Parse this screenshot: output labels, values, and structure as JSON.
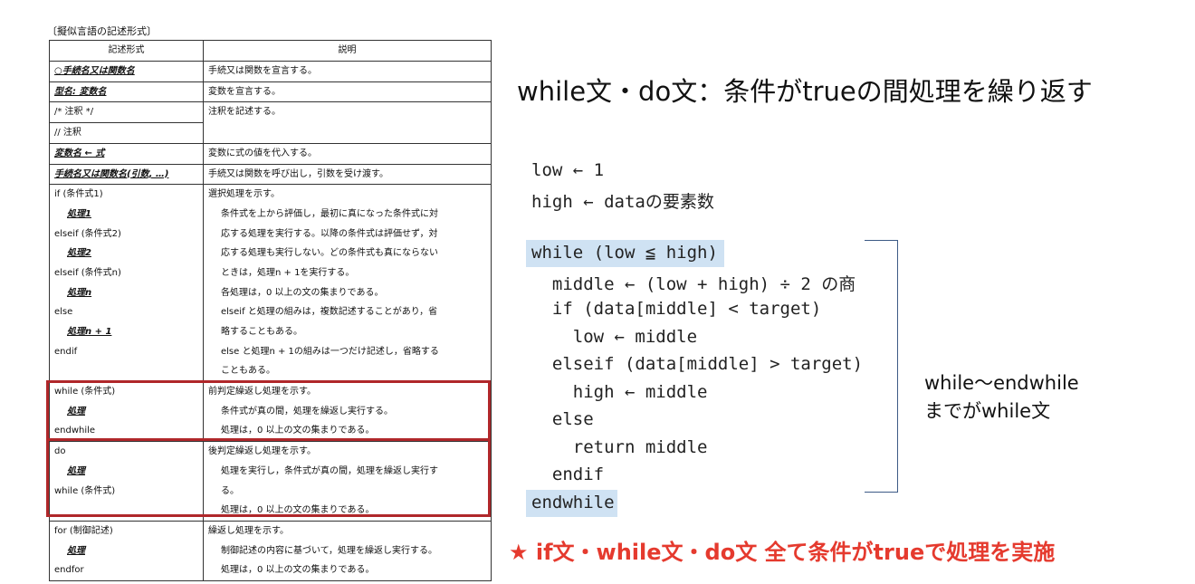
{
  "table_caption": "〔擬似言語の記述形式〕",
  "table": {
    "headers": [
      "記述形式",
      "説明"
    ],
    "rows": {
      "r1": {
        "form": "○手続名又は関数名",
        "desc": "手続又は関数を宣言する。"
      },
      "r2": {
        "form": "型名: 変数名",
        "desc": "変数を宣言する。"
      },
      "r3": {
        "form": "/* 注釈 */",
        "desc": "注釈を記述する。"
      },
      "r4": {
        "form": "// 注釈"
      },
      "r5": {
        "form": "変数名 ← 式",
        "desc": "変数に式の値を代入する。"
      },
      "r6": {
        "form": "手続名又は関数名(引数, …)",
        "desc": "手続又は関数を呼び出し，引数を受け渡す。"
      },
      "r7": {
        "form": [
          "if (条件式1)",
          "処理1",
          "elseif (条件式2)",
          "処理2",
          "elseif (条件式n)",
          "処理n",
          "else",
          "処理n + 1",
          "endif"
        ],
        "desc": [
          "選択処理を示す。",
          "条件式を上から評価し，最初に真になった条件式に対",
          "応する処理を実行する。以降の条件式は評価せず，対",
          "応する処理も実行しない。どの条件式も真にならない",
          "ときは，処理n + 1を実行する。",
          "各処理は，0 以上の文の集まりである。",
          "elseif と処理の組みは，複数記述することがあり，省",
          "略することもある。",
          "else と処理n + 1の組みは一つだけ記述し，省略する",
          "こともある。"
        ]
      },
      "r8": {
        "form": [
          "while (条件式)",
          "処理",
          "endwhile"
        ],
        "desc": [
          "前判定繰返し処理を示す。",
          "条件式が真の間，処理を繰返し実行する。",
          "処理は，0 以上の文の集まりである。"
        ]
      },
      "r9": {
        "form": [
          "do",
          "処理",
          "while (条件式)"
        ],
        "desc": [
          "後判定繰返し処理を示す。",
          "処理を実行し，条件式が真の間，処理を繰返し実行す",
          "る。",
          "処理は，0 以上の文の集まりである。"
        ]
      },
      "r10": {
        "form": [
          "for (制御記述)",
          "処理",
          "endfor"
        ],
        "desc": [
          "繰返し処理を示す。",
          "制御記述の内容に基づいて，処理を繰返し実行する。",
          "処理は，0 以上の文の集まりである。"
        ]
      }
    }
  },
  "slide_title": "while文・do文：条件がtrueの間処理を繰り返す",
  "code_lines": [
    "low ← 1",
    "high ← dataの要素数",
    "while (low ≦ high)",
    "  middle ← (low + high) ÷ 2 の商",
    "  if (data[middle] < target)",
    "    low ← middle",
    "  elseif (data[middle] > target)",
    "    high ← middle",
    "  else",
    "    return middle",
    "  endif",
    "endwhile"
  ],
  "bracket_note": [
    "while～endwhile",
    "までがwhile文"
  ],
  "summary_line": "★ if文・while文・do文 全て条件がtrueで処理を実施",
  "colors": {
    "highlight_border": "#b0272a",
    "code_highlight": "#cfe2f3",
    "summary_text": "#e53a2e",
    "bracket": "#3d5a86"
  }
}
